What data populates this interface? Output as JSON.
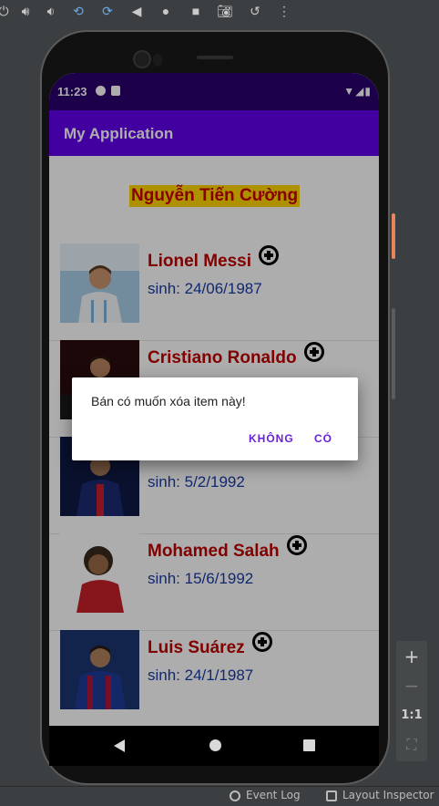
{
  "emulator_toolbar": {
    "icons": [
      "power-icon",
      "volume-up-icon",
      "volume-down-icon",
      "rotate-left-icon",
      "rotate-right-icon",
      "back-icon",
      "home-icon",
      "overview-icon",
      "camera-icon",
      "replay-icon",
      "more-icon"
    ]
  },
  "status_bar": {
    "time": "11:23",
    "right_glyphs": "▼◢▮"
  },
  "app_bar": {
    "title": "My Application"
  },
  "owner": {
    "name": "Nguyễn Tiến Cường"
  },
  "players": [
    {
      "name": "Lionel Messi",
      "birth": "sinh: 24/06/1987",
      "thumb_color": "#8fbde0"
    },
    {
      "name": "Cristiano Ronaldo",
      "birth": "",
      "thumb_color": "#7a1414"
    },
    {
      "name": "",
      "birth": "sinh: 5/2/1992",
      "thumb_color": "#17245e"
    },
    {
      "name": "Mohamed Salah",
      "birth": "sinh: 15/6/1992",
      "thumb_color": "#f2f2f2"
    },
    {
      "name": "Luis Suárez",
      "birth": "sinh: 24/1/1987",
      "thumb_color": "#274a96"
    }
  ],
  "dialog": {
    "message": "Bán có muốn xóa item này!",
    "negative_label": "KHÔNG",
    "positive_label": "CÓ"
  },
  "zoom_panel": {
    "plus": "+",
    "minus": "−",
    "ratio": "1:1",
    "fit": "⛶"
  },
  "ide_bottom": {
    "event_log": "Event Log",
    "layout_inspector": "Layout Inspector"
  }
}
